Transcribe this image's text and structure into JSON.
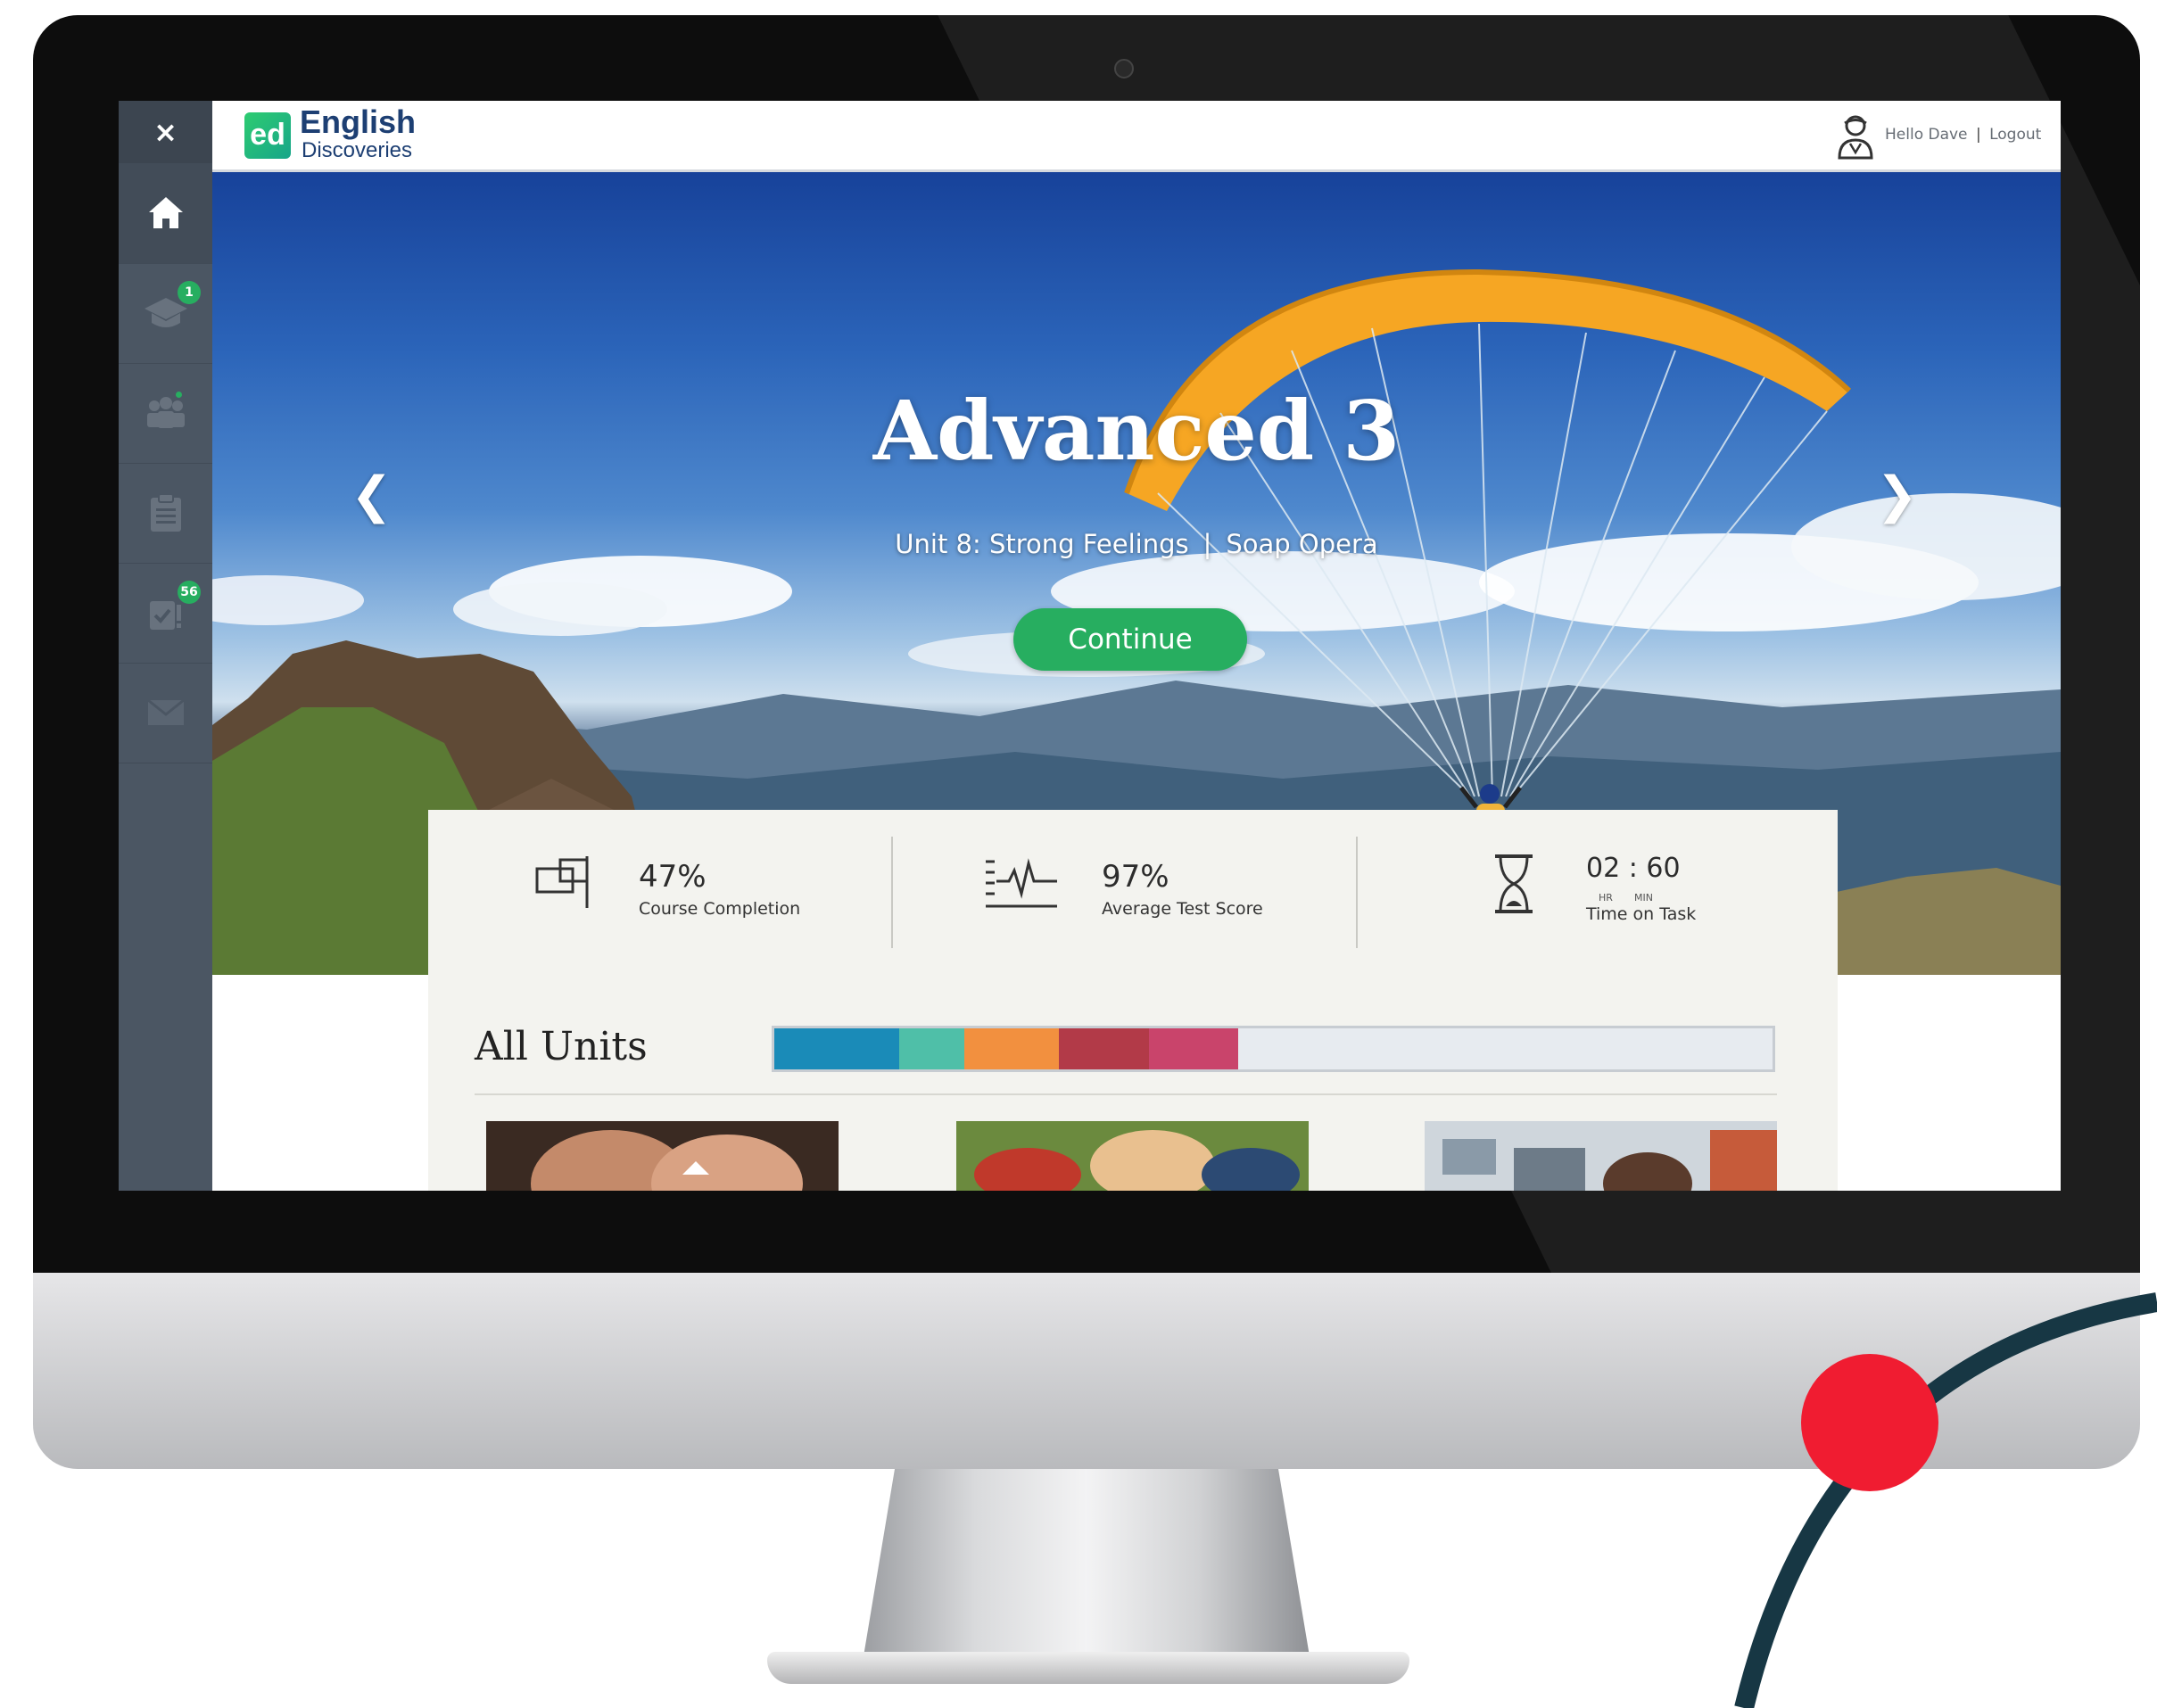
{
  "sidebar": {
    "close_label": "×",
    "items": [
      {
        "icon": "home-icon",
        "active": true
      },
      {
        "icon": "graduation-cap-icon",
        "badge": "1"
      },
      {
        "icon": "community-icon",
        "dot": true
      },
      {
        "icon": "clipboard-icon"
      },
      {
        "icon": "tasks-icon",
        "badge": "56"
      },
      {
        "icon": "mail-icon"
      }
    ]
  },
  "header": {
    "logo_mark": "ed",
    "logo_name": "English",
    "logo_sub": "Discoveries",
    "greeting": "Hello Dave",
    "separator": "|",
    "logout": "Logout"
  },
  "hero": {
    "title": "Advanced 3",
    "unit": "Unit 8: Strong Feelings",
    "separator": "|",
    "lesson": "Soap Opera",
    "continue_label": "Continue",
    "prev_arrow": "❮",
    "next_arrow": "❯"
  },
  "stats": {
    "completion": {
      "value": "47%",
      "label": "Course Completion"
    },
    "score": {
      "value": "97%",
      "label": "Average Test Score"
    },
    "time": {
      "value": "02 : 60",
      "hr": "HR",
      "min": "MIN",
      "label": "Time on Task"
    }
  },
  "units": {
    "title": "All Units",
    "progress_segments": [
      {
        "color": "#1a8bb8",
        "fraction": 0.125
      },
      {
        "color": "#4fbfa8",
        "fraction": 0.065
      },
      {
        "color": "#f2903f",
        "fraction": 0.095
      },
      {
        "color": "#b23a48",
        "fraction": 0.09
      },
      {
        "color": "#c9446b",
        "fraction": 0.09
      }
    ]
  },
  "colors": {
    "accent": "#27ae60",
    "sidebar": "#4b5663",
    "brand": "#1d3f73",
    "red_dot": "#f01c31",
    "arc": "#173744"
  }
}
